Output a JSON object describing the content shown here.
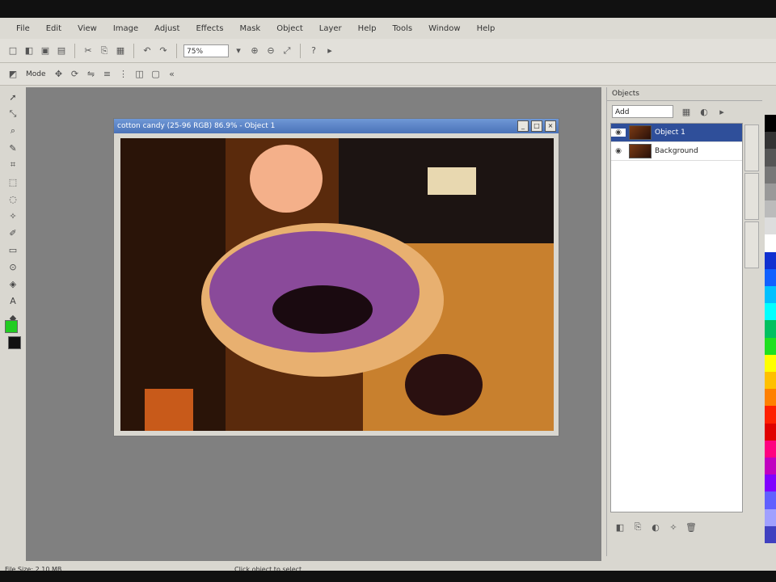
{
  "menu": [
    "File",
    "Edit",
    "View",
    "Image",
    "Adjust",
    "Effects",
    "Mask",
    "Object",
    "Layer",
    "Help",
    "Tools",
    "Window",
    "Help"
  ],
  "toolbar": {
    "zoom": "75%",
    "mode_label": "Mode"
  },
  "document": {
    "title": "cotton candy (25-96 RGB) 86.9% - Object 1"
  },
  "panel": {
    "title": "Objects",
    "mode": "Add",
    "layers": [
      {
        "name": "Object 1",
        "selected": true
      },
      {
        "name": "Background",
        "selected": false
      }
    ]
  },
  "status": {
    "file_size": "File Size: 2.10 MB",
    "hint": "Click object to select"
  },
  "colors": {
    "accent": "#2f4f9a",
    "foreground_swatch": "#22cc22",
    "background_swatch": "#111111"
  },
  "palette": [
    "#000000",
    "#333333",
    "#555555",
    "#777777",
    "#999999",
    "#bbbbbb",
    "#dddddd",
    "#ffffff",
    "#1030d0",
    "#1060ff",
    "#00c0ff",
    "#00ffff",
    "#00c060",
    "#20e020",
    "#ffff00",
    "#ffc000",
    "#ff8000",
    "#ff2000",
    "#e00000",
    "#ff0080",
    "#c000c0",
    "#8000ff",
    "#6060ff",
    "#a0a0ff",
    "#4040c0"
  ]
}
